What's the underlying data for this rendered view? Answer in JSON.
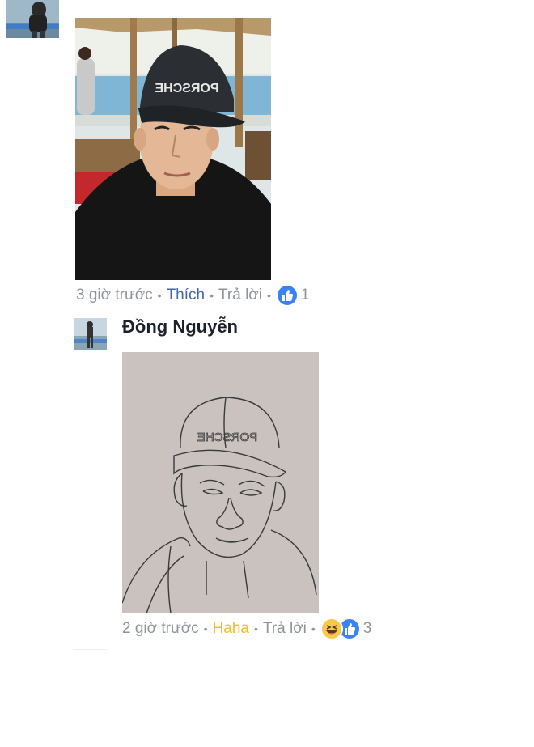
{
  "comments": [
    {
      "author": "",
      "time": "3 giờ trước",
      "action_link": "Thích",
      "reply_label": "Trả lời",
      "reaction_icons": [
        "like-icon"
      ],
      "reaction_count": "1",
      "reaction_colors": {
        "like": "#3b82f6"
      },
      "image_desc": "selfie-black-cap"
    },
    {
      "author": "Đồng Nguyễn",
      "time": "2 giờ trước",
      "action_link": "Haha",
      "reply_label": "Trả lời",
      "reaction_icons": [
        "haha-icon",
        "like-icon"
      ],
      "reaction_count": "3",
      "reaction_colors": {
        "haha": "#f7c948",
        "like": "#3b82f6"
      },
      "image_desc": "pencil-sketch",
      "cap_text": "PORSCHE"
    }
  ],
  "colors": {
    "link_blue": "#4267b2",
    "haha_yellow": "#f7b928",
    "meta_grey": "#90949c"
  }
}
